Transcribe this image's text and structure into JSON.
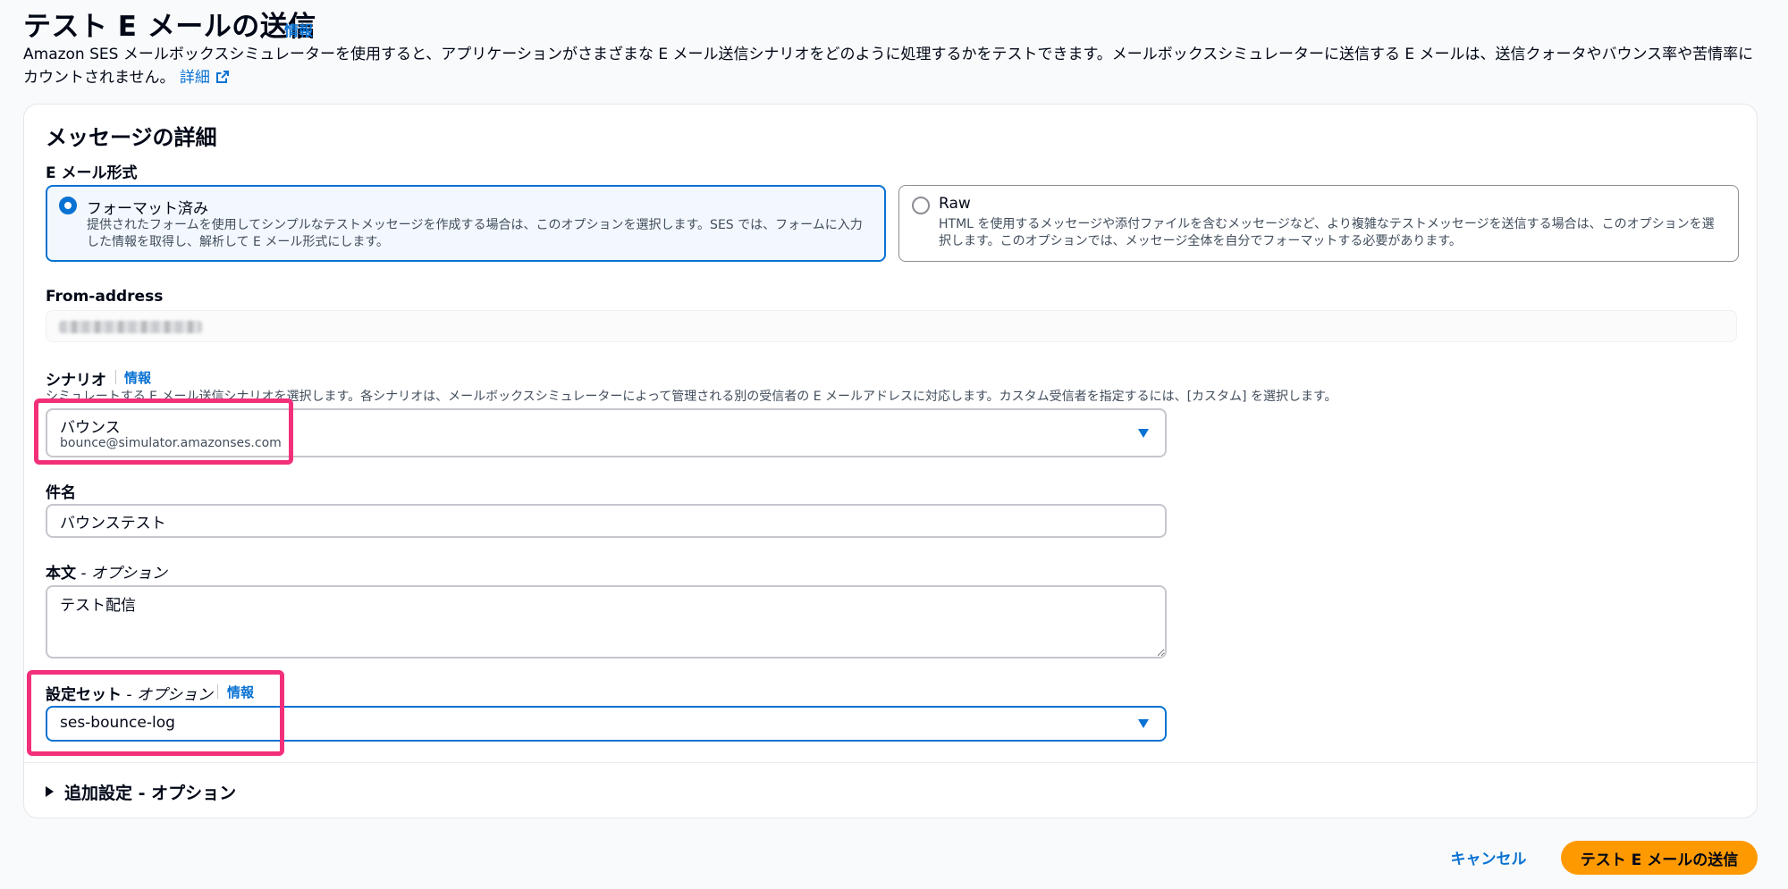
{
  "header": {
    "title": "テスト E メールの送信",
    "info_label": "情報",
    "description": "Amazon SES メールボックスシミュレーターを使用すると、アプリケーションがさまざまな E メール送信シナリオをどのように処理するかをテストできます。メールボックスシミュレーターに送信する E メールは、送信クォータやバウンス率や苦情率にカウントされません。",
    "detail_link": "詳細"
  },
  "message_details": {
    "title": "メッセージの詳細",
    "email_format": {
      "label": "E メール形式",
      "options": [
        {
          "title": "フォーマット済み",
          "description": "提供されたフォームを使用してシンプルなテストメッセージを作成する場合は、このオプションを選択します。SES では、フォームに入力した情報を取得し、解析して E メール形式にします。",
          "selected": true
        },
        {
          "title": "Raw",
          "description": "HTML を使用するメッセージや添付ファイルを含むメッセージなど、より複雑なテストメッセージを送信する場合は、このオプションを選択します。このオプションでは、メッセージ全体を自分でフォーマットする必要があります。",
          "selected": false
        }
      ]
    },
    "from_address": {
      "label": "From-address"
    },
    "scenario": {
      "label": "シナリオ",
      "info_label": "情報",
      "hint": "シミュレートする E メール送信シナリオを選択します。各シナリオは、メールボックスシミュレーターによって管理される別の受信者の E メールアドレスに対応します。カスタム受信者を指定するには、[カスタム] を選択します。",
      "selected_label": "バウンス",
      "selected_address": "bounce@simulator.amazonses.com"
    },
    "subject": {
      "label": "件名",
      "value": "バウンステスト"
    },
    "body": {
      "label": "本文",
      "optional_suffix": " - オプション",
      "value": "テスト配信"
    },
    "configuration_set": {
      "label": "設定セット",
      "optional_suffix": " - オプション",
      "info_label": "情報",
      "selected": "ses-bounce-log"
    },
    "additional_settings": {
      "label": "追加設定 - オプション"
    }
  },
  "actions": {
    "cancel": "キャンセル",
    "send": "テスト E メールの送信"
  },
  "colors": {
    "accent": "#0972d3",
    "primary_button": "#ff9900",
    "highlight": "#f2307a"
  }
}
